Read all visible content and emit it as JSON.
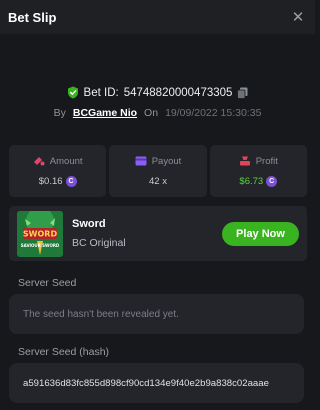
{
  "header": {
    "title": "Bet Slip",
    "close_icon": "close-icon"
  },
  "bet": {
    "id_label": "Bet ID:",
    "id_value": "54748820000473305",
    "by_label": "By",
    "user": "BCGame Nio",
    "on_label": "On",
    "date": "19/09/2022 15:30:35"
  },
  "stats": {
    "amount": {
      "label": "Amount",
      "value": "$0.16",
      "icon": "amount-icon"
    },
    "payout": {
      "label": "Payout",
      "value": "42 x",
      "icon": "payout-icon"
    },
    "profit": {
      "label": "Profit",
      "value": "$6.73",
      "icon": "profit-icon"
    }
  },
  "game": {
    "name": "Sword",
    "provider": "BC Original",
    "play_label": "Play Now",
    "thumb_title": "SWORD",
    "thumb_subtitle": "SAVIOUR SWORD"
  },
  "server_seed": {
    "label": "Server Seed",
    "value": "The seed hasn't been revealed yet."
  },
  "server_seed_hash": {
    "label": "Server Seed (hash)",
    "value": "a591636d83fc855d898cf90cd134e9f40e2b9a838c02aaae"
  },
  "colors": {
    "background": "#17181b",
    "panel": "#23252a",
    "accent_green": "#3ab320",
    "profit_green": "#5bd23c",
    "coin_purple": "#7b4fd8"
  }
}
